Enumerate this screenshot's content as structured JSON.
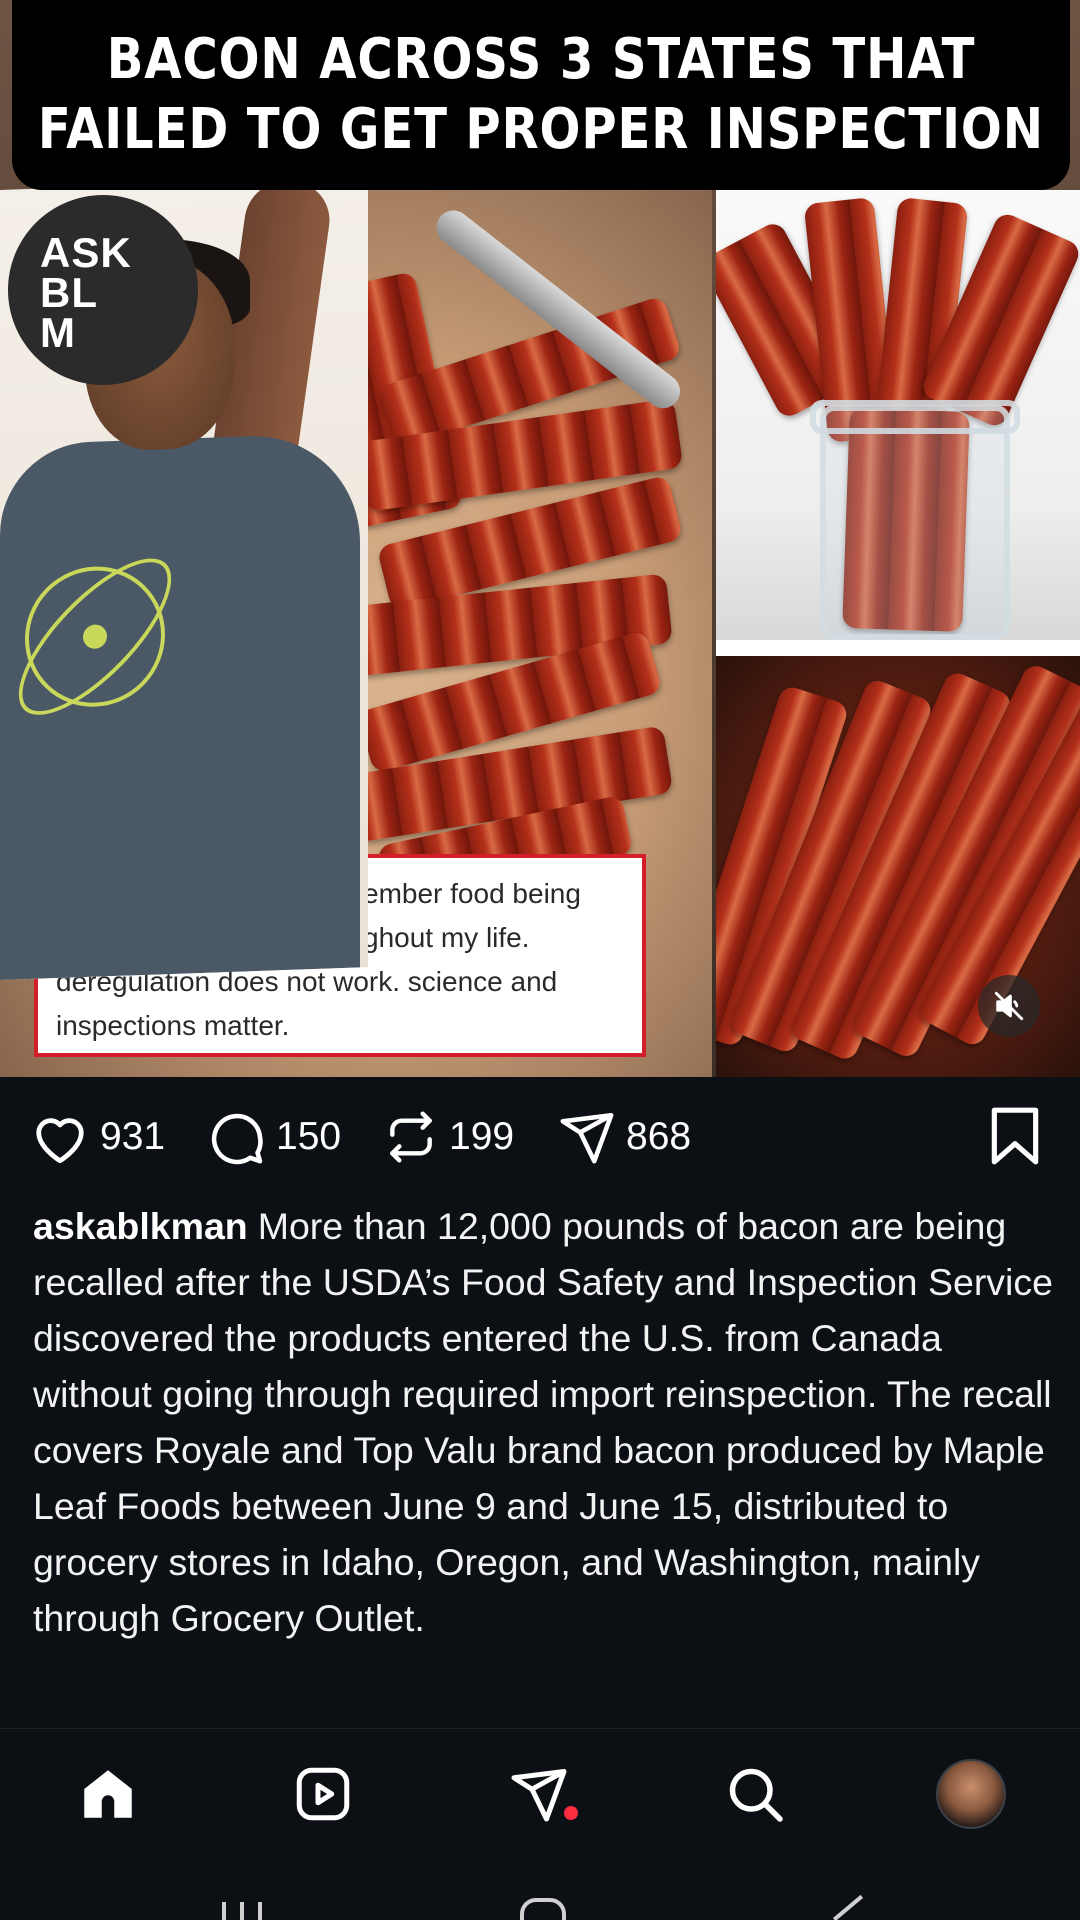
{
  "post": {
    "banner": {
      "line1": "BACON ACROSS 3 STATES THAT",
      "line2": "FAILED TO GET PROPER INSPECTION"
    },
    "logo_text": [
      "ASK",
      "BL",
      "M"
    ],
    "quote_lines": [
      "ember food being",
      "ghout my life.",
      "deregulation does not work. science and",
      "inspections matter."
    ],
    "actions": {
      "likes": "931",
      "comments": "150",
      "reposts": "199",
      "shares": "868"
    },
    "caption": {
      "username": "askablkman",
      "text": "More than 12,000 pounds of bacon are being recalled after the USDA’s Food Safety and Inspection Service discovered the products entered the U.S. from Canada without going through required import reinspection. The recall covers Royale and Top Valu brand bacon produced by Maple Leaf Foods between June 9 and June 15, distributed to grocery stores in Idaho, Oregon, and Washington, mainly through Grocery Outlet."
    }
  },
  "icons": {
    "like": "heart-icon",
    "comment": "comment-bubble-icon",
    "repost": "repost-icon",
    "share": "send-icon",
    "save": "bookmark-icon",
    "mute": "muted-speaker-icon",
    "nav": [
      "home-icon",
      "reels-icon",
      "messages-icon",
      "search-icon",
      "profile-avatar"
    ]
  },
  "colors": {
    "background": "#0c0f14",
    "notification_dot": "#ff2d3f",
    "quote_border": "#d41f2a"
  }
}
